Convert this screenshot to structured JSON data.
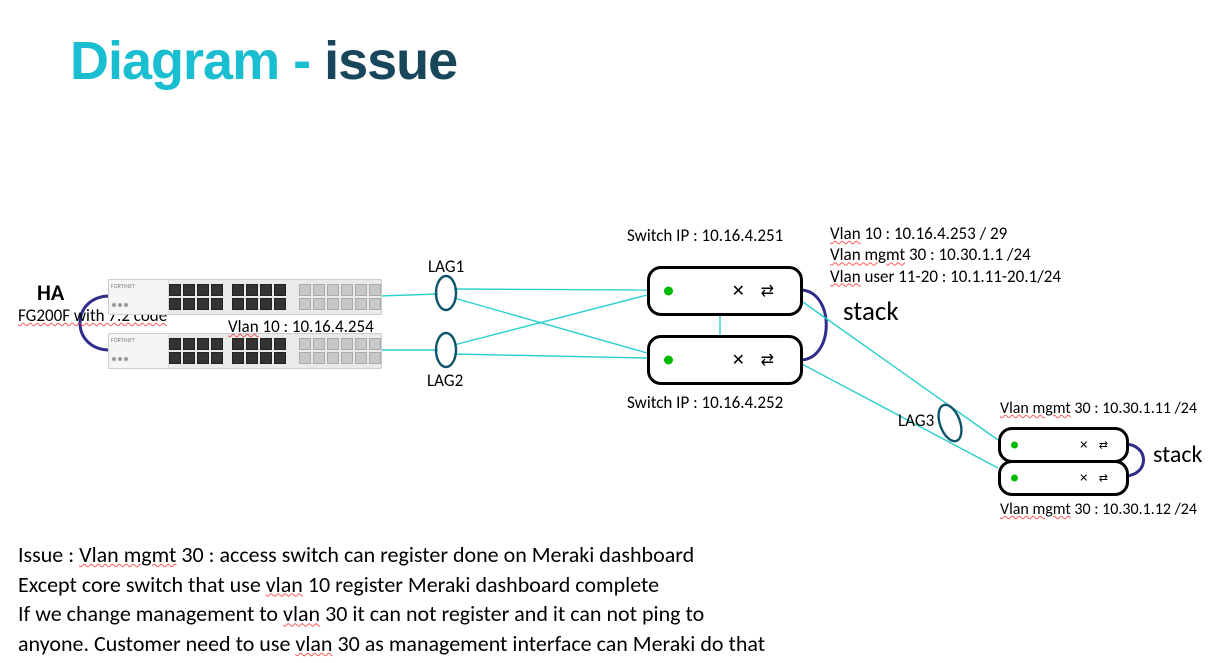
{
  "title_part1": "Diagram - ",
  "title_part2": "issue",
  "ha_label": "HA",
  "fg_label": "FG200F with 7.2 code",
  "vlan10_fw": "Vlan 10 : 10.16.4.254",
  "lag1": "LAG1",
  "lag2": "LAG2",
  "lag3": "LAG3",
  "switch_ip_top": "Switch IP : 10.16.4.251",
  "switch_ip_bot": "Switch IP : 10.16.4.252",
  "core_vlan_line1": "Vlan 10 : 10.16.4.253  / 29",
  "core_vlan_line2": "Vlan mgmt  30 : 10.30.1.1  /24",
  "core_vlan_line3": "Vlan user 11-20 : 10.1.11-20.1/24",
  "stack1": "stack",
  "stack2": "stack",
  "access_vlan_top": "Vlan mgmt  30 : 10.30.1.11 /24",
  "access_vlan_bot": "Vlan mgmt  30 : 10.30.1.12 /24",
  "issue_line1a": "Issue : ",
  "issue_line1b": "Vlan mgmt",
  "issue_line1c": "  30 :  access switch can register done on Meraki dashboard",
  "issue_line2a": "Except core switch that use ",
  "issue_line2b": "vlan",
  "issue_line2c": " 10 register Meraki dashboard complete",
  "issue_line3a": "If we change management to ",
  "issue_line3b": "vlan",
  "issue_line3c": " 30 it can not register and it can not ping to",
  "issue_line4a": "anyone.  Customer need to use ",
  "issue_line4b": "vlan",
  "issue_line4c": " 30 as management interface can Meraki do that"
}
